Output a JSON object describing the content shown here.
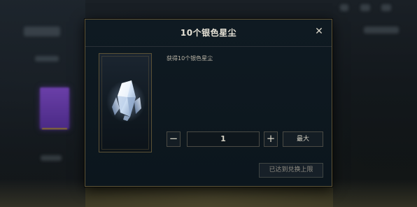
{
  "dialog": {
    "title": "10个银色星尘",
    "close_icon": "close-icon",
    "close_glyph": "✕",
    "description": "获得10个银色星尘",
    "item_icon": "silver-stardust-crystal-icon"
  },
  "quantity": {
    "minus_label": "−",
    "value": "1",
    "plus_label": "+",
    "max_label": "最大"
  },
  "redeem": {
    "label": "已达到兑换上限"
  },
  "colors": {
    "border_gold": "#5f5538",
    "panel_bg": "#0f1a22",
    "text_light": "#e6e2d6"
  }
}
